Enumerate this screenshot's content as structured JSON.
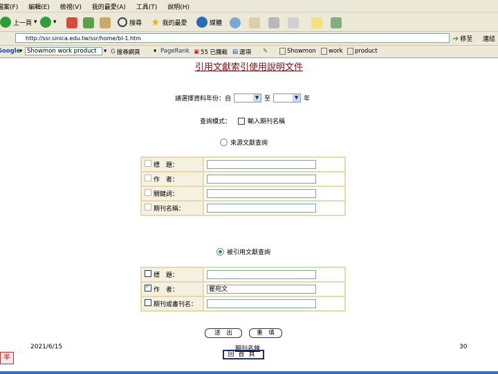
{
  "menu": [
    "檔案(F)",
    "編輯(E)",
    "檢視(V)",
    "我的最愛(A)",
    "工具(T)",
    "說明(H)"
  ],
  "toolbar": {
    "back": "上一頁",
    "search": "搜尋",
    "favorites": "我的最愛",
    "media": "媒體"
  },
  "address": {
    "url": "http://ssr.sinica.edu.tw/ssr/home/bl-1.htm",
    "go": "移至",
    "links": "連結"
  },
  "google_bar": {
    "logo": "Google",
    "query": "Showmon work product",
    "search_web": "搜尋網頁",
    "pagerank": "PageRank",
    "blocked": "55 已攔截",
    "options": "選項",
    "words": [
      "Showmon",
      "work",
      "product"
    ]
  },
  "page": {
    "title": "引用文獻索引使用說明文件",
    "year_label": "請選擇資料年份：自",
    "year_to": "至",
    "year_unit": "年",
    "query_mode_label": "查詢模式：",
    "journal_name_option": "輸入期刊名稱",
    "section1": {
      "radio_label": "來源文獻查詢",
      "selected": false,
      "rows": [
        {
          "label": "標　題：",
          "checked": false,
          "value": ""
        },
        {
          "label": "作　者：",
          "checked": false,
          "value": ""
        },
        {
          "label": "關鍵詞：",
          "checked": false,
          "value": ""
        },
        {
          "label": "期刊名稱：",
          "checked": false,
          "value": ""
        }
      ]
    },
    "section2": {
      "radio_label": "被引用文獻查詢",
      "selected": true,
      "rows": [
        {
          "label": "標　題：",
          "checked": false,
          "value": ""
        },
        {
          "label": "作　者：",
          "checked": true,
          "value": "瞿宛文"
        },
        {
          "label": "期刊或書刊名：",
          "checked": false,
          "value": ""
        }
      ]
    },
    "submit": "送　出",
    "reset": "重　填",
    "journal_list": "期刊名錄",
    "home": "回首頁"
  },
  "slide": {
    "date": "2021/6/15",
    "number": "30",
    "bottom_left": "半"
  },
  "colors": {
    "title": "#7a1010",
    "table_border": "#e5d9a8",
    "chrome": "#ece9d8"
  }
}
